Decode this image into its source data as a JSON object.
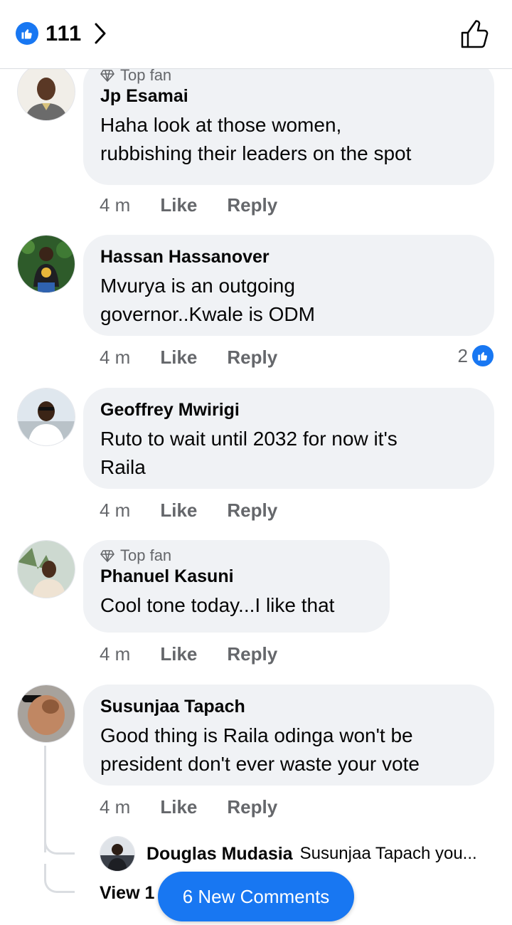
{
  "header": {
    "like_count": "111",
    "icons": {
      "reaction": "like-icon",
      "chevron": "chevron-right-icon",
      "like_button": "thumbs-up-outline-icon"
    }
  },
  "colors": {
    "accent": "#1877f2",
    "bubble": "#f0f2f5",
    "muted": "#65676b"
  },
  "comments": [
    {
      "badge": "Top fan",
      "author": "Jp Esamai",
      "lines": [
        "Haha look at those women,",
        "rubbishing their leaders on the spot"
      ],
      "time": "4 m",
      "like": "Like",
      "reply": "Reply"
    },
    {
      "author": "Hassan Hassanover",
      "lines": [
        "Mvurya is an outgoing",
        "governor..Kwale is ODM"
      ],
      "time": "4 m",
      "like": "Like",
      "reply": "Reply",
      "reactions": "2"
    },
    {
      "author": "Geoffrey Mwirigi",
      "lines": [
        "Ruto to wait until 2032 for now it's",
        "Raila"
      ],
      "time": "4 m",
      "like": "Like",
      "reply": "Reply"
    },
    {
      "badge": "Top fan",
      "author": "Phanuel Kasuni",
      "lines": [
        "Cool tone today...I like that"
      ],
      "time": "4 m",
      "like": "Like",
      "reply": "Reply"
    },
    {
      "author": "Susunjaa Tapach",
      "lines": [
        "Good thing is Raila odinga won't be",
        "president don't ever waste your vote"
      ],
      "time": "4 m",
      "like": "Like",
      "reply": "Reply"
    }
  ],
  "reply_preview": {
    "author": "Douglas Mudasia",
    "snippet": "Susunjaa Tapach you..."
  },
  "view_more": "View 1",
  "new_comments": "6 New Comments"
}
